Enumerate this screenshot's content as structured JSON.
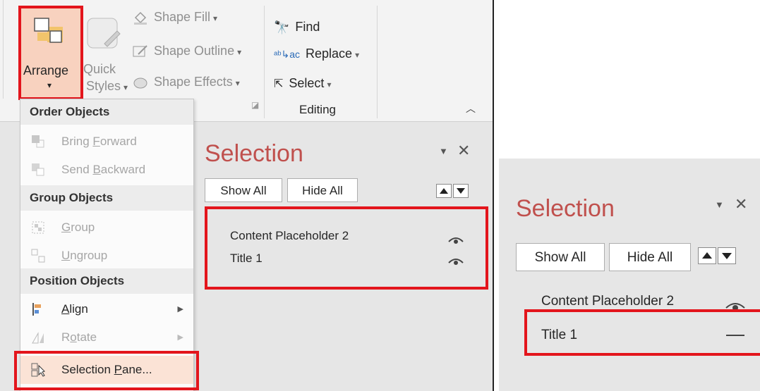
{
  "ribbon": {
    "arrange_label": "Arrange",
    "quick_styles_line1": "Quick",
    "quick_styles_line2": "Styles",
    "shape_fill": "Shape Fill",
    "shape_outline": "Shape Outline",
    "shape_effects": "Shape Effects",
    "find": "Find",
    "replace": "Replace",
    "select": "Select",
    "editing_group": "Editing"
  },
  "arrange_menu": {
    "order_header": "Order Objects",
    "bring_forward": {
      "pre": "Bring ",
      "key": "F",
      "post": "orward"
    },
    "send_backward": {
      "pre": "Send ",
      "key": "B",
      "post": "ackward"
    },
    "group_header": "Group Objects",
    "group": {
      "pre": "",
      "key": "G",
      "post": "roup"
    },
    "ungroup": {
      "pre": "",
      "key": "U",
      "post": "ngroup"
    },
    "position_header": "Position Objects",
    "align": {
      "pre": "",
      "key": "A",
      "post": "lign"
    },
    "rotate": {
      "pre": "R",
      "key": "o",
      "post": "tate"
    },
    "selection_pane": {
      "pre": "Selection ",
      "key": "P",
      "post": "ane..."
    }
  },
  "selection_pane_left": {
    "title": "Selection",
    "show_all": "Show All",
    "hide_all": "Hide All",
    "items": [
      "Content Placeholder 2",
      "Title 1"
    ]
  },
  "selection_pane_right": {
    "title": "Selection",
    "show_all": "Show All",
    "hide_all": "Hide All",
    "items": [
      "Content Placeholder 2",
      "Title 1"
    ]
  },
  "colors": {
    "highlight": "#e3151c",
    "pane_title": "#c0504d",
    "arrange_active": "#f8d2bf"
  }
}
